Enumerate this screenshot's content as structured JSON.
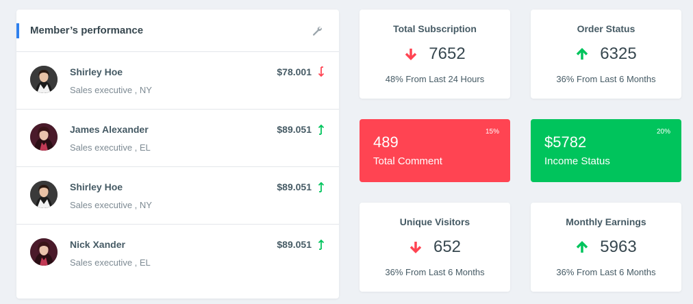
{
  "performance": {
    "title": "Member’s performance",
    "settings_icon": "wrench-icon",
    "members": [
      {
        "name": "Shirley Hoe",
        "role": "Sales executive , NY",
        "amount": "$78.001",
        "trend": "down",
        "avatar": "female-avatar-1"
      },
      {
        "name": "James Alexander",
        "role": "Sales executive , EL",
        "amount": "$89.051",
        "trend": "up",
        "avatar": "female-avatar-2"
      },
      {
        "name": "Shirley Hoe",
        "role": "Sales executive , NY",
        "amount": "$89.051",
        "trend": "up",
        "avatar": "female-avatar-1"
      },
      {
        "name": "Nick Xander",
        "role": "Sales executive , EL",
        "amount": "$89.051",
        "trend": "up",
        "avatar": "female-avatar-2"
      }
    ]
  },
  "stats": {
    "total_subscription": {
      "title": "Total Subscription",
      "value": "7652",
      "trend": "down",
      "sub": "48% From Last 24 Hours"
    },
    "order_status": {
      "title": "Order Status",
      "value": "6325",
      "trend": "up",
      "sub": "36% From Last 6 Months"
    },
    "unique_visitors": {
      "title": "Unique Visitors",
      "value": "652",
      "trend": "down",
      "sub": "36% From Last 6 Months"
    },
    "monthly_earnings": {
      "title": "Monthly Earnings",
      "value": "5963",
      "trend": "up",
      "sub": "36% From Last 6 Months"
    }
  },
  "highlights": {
    "comment": {
      "value": "489",
      "label": "Total Comment",
      "percent": "15%",
      "color": "#ff4452"
    },
    "income": {
      "value": "$5782",
      "label": "Income Status",
      "percent": "20%",
      "color": "#00c45c"
    }
  },
  "colors": {
    "up": "#00c45c",
    "down": "#ff4452",
    "accent": "#2f80ed"
  }
}
